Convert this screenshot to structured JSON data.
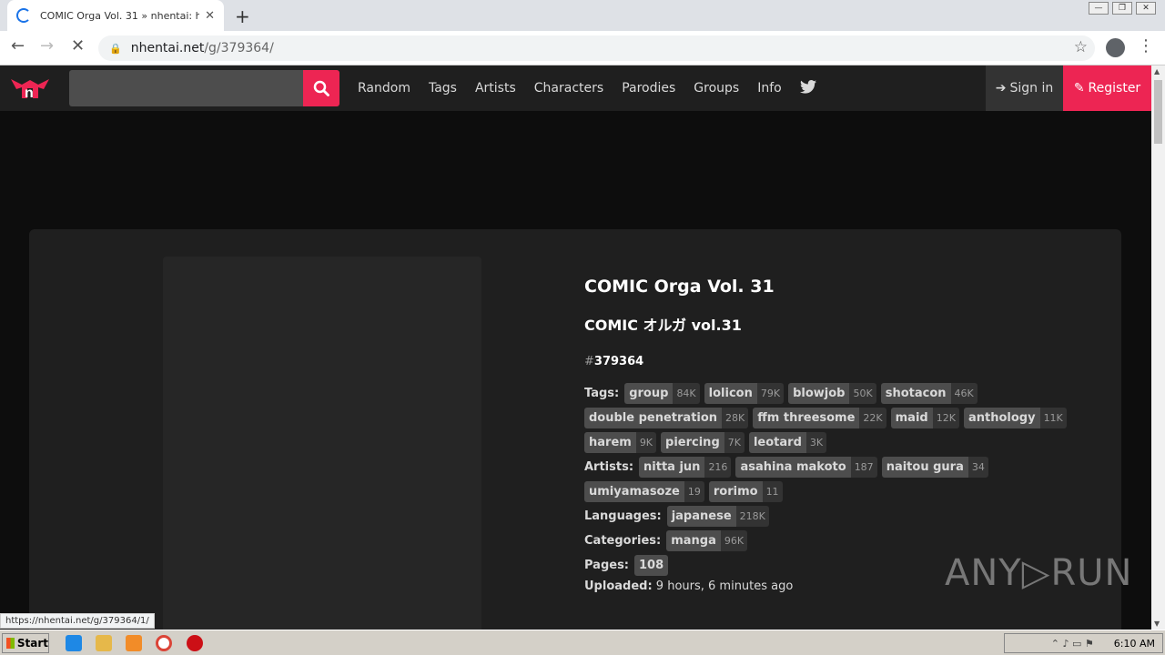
{
  "browser": {
    "tab_title": "COMIC Orga Vol. 31 » nhentai: hent",
    "tab_close": "✕",
    "new_tab": "+",
    "window_controls": [
      "—",
      "❐",
      "✕"
    ],
    "url_host": "nhentai.net",
    "url_path": "/g/379364/",
    "status_url": "https://nhentai.net/g/379364/1/"
  },
  "nav": {
    "links": [
      "Random",
      "Tags",
      "Artists",
      "Characters",
      "Parodies",
      "Groups",
      "Info"
    ],
    "signin_label": "Sign in",
    "register_label": "Register"
  },
  "gallery": {
    "title": "COMIC Orga Vol. 31",
    "subtitle": "COMIC オルガ vol.31",
    "id_hash": "#",
    "id": "379364",
    "fields": {
      "tags_label": "Tags:",
      "tags": [
        {
          "name": "group",
          "count": "84K"
        },
        {
          "name": "lolicon",
          "count": "79K"
        },
        {
          "name": "blowjob",
          "count": "50K"
        },
        {
          "name": "shotacon",
          "count": "46K"
        },
        {
          "name": "double penetration",
          "count": "28K"
        },
        {
          "name": "ffm threesome",
          "count": "22K"
        },
        {
          "name": "maid",
          "count": "12K"
        },
        {
          "name": "anthology",
          "count": "11K"
        },
        {
          "name": "harem",
          "count": "9K"
        },
        {
          "name": "piercing",
          "count": "7K"
        },
        {
          "name": "leotard",
          "count": "3K"
        }
      ],
      "artists_label": "Artists:",
      "artists": [
        {
          "name": "nitta jun",
          "count": "216"
        },
        {
          "name": "asahina makoto",
          "count": "187"
        },
        {
          "name": "naitou gura",
          "count": "34"
        },
        {
          "name": "umiyamasoze",
          "count": "19"
        },
        {
          "name": "rorimo",
          "count": "11"
        }
      ],
      "languages_label": "Languages:",
      "languages": [
        {
          "name": "japanese",
          "count": "218K"
        }
      ],
      "categories_label": "Categories:",
      "categories": [
        {
          "name": "manga",
          "count": "96K"
        }
      ],
      "pages_label": "Pages:",
      "pages": "108",
      "uploaded_label": "Uploaded:",
      "uploaded": "9 hours, 6 minutes ago"
    }
  },
  "watermark": "ANY▷RUN",
  "taskbar": {
    "start_label": "Start",
    "clock": "6:10 AM"
  }
}
